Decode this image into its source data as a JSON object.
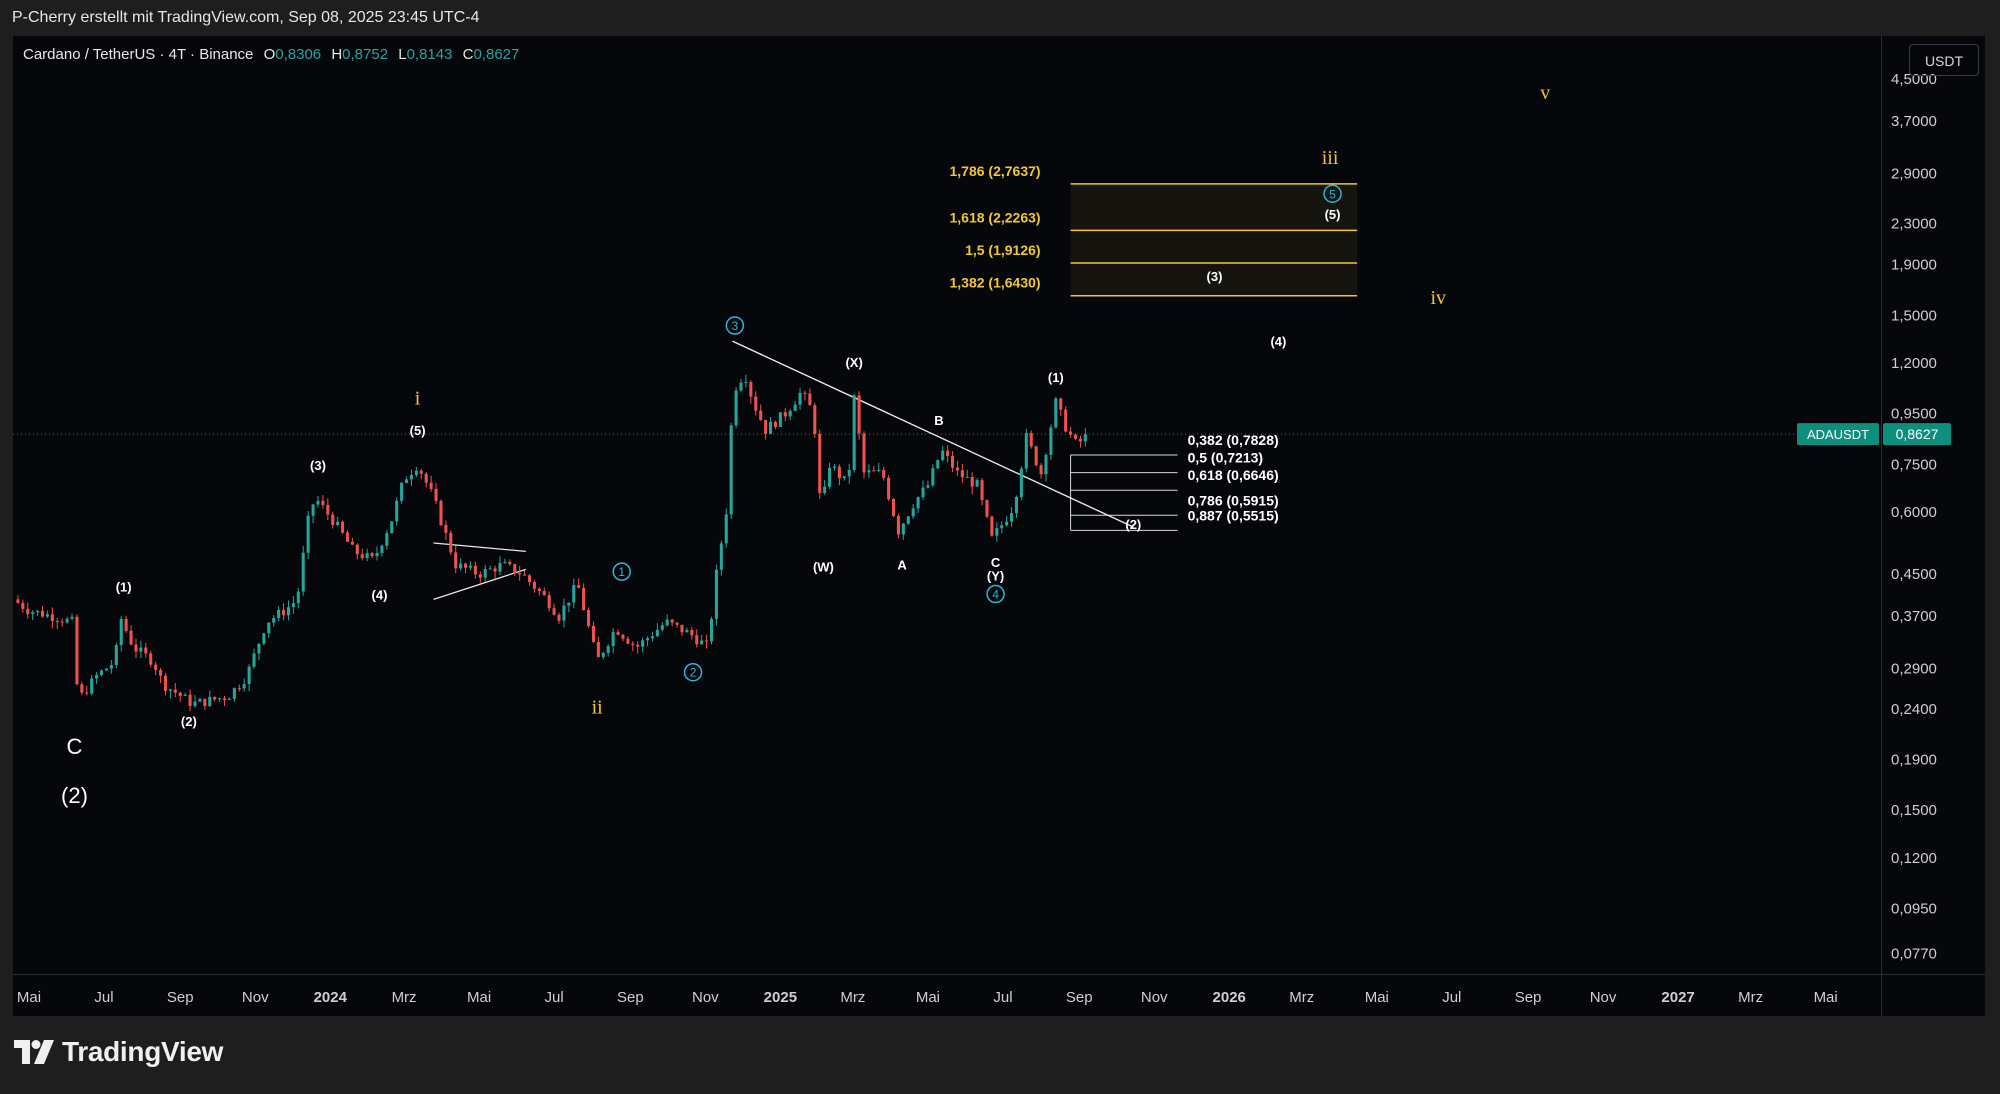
{
  "header": {
    "credit": "P-Cherry erstellt mit TradingView.com, Sep 08, 2025 23:45 UTC-4"
  },
  "symbol": {
    "name": "Cardano / TetherUS · 4T · Binance",
    "o_label": "O",
    "o_value": "0,8306",
    "h_label": "H",
    "h_value": "0,8752",
    "l_label": "L",
    "l_value": "0,8143",
    "c_label": "C",
    "c_value": "0,8627"
  },
  "currency_button": "USDT",
  "price_tag": {
    "ticker": "ADAUSDT",
    "value": "0,8627",
    "price": 0.8627
  },
  "brand": {
    "name": "TradingView"
  },
  "colors": {
    "background": "#06070b",
    "up": "#26a69a",
    "down": "#ef5350",
    "fib_target": "#f2c53d",
    "circle_wave": "#2fb6d8",
    "text": "#e8e8e8"
  },
  "chart_data": {
    "type": "candlestick",
    "symbol": "ADAUSDT",
    "timeframe": "4T",
    "yscale": "log",
    "ylim": [
      0.07,
      5.5
    ],
    "xlim": [
      "2023-04-18",
      "2027-06-15"
    ],
    "y_ticks": [
      {
        "value": 4.5,
        "label": "4,5000"
      },
      {
        "value": 3.7,
        "label": "3,7000"
      },
      {
        "value": 2.9,
        "label": "2,9000"
      },
      {
        "value": 2.3,
        "label": "2,3000"
      },
      {
        "value": 1.9,
        "label": "1,9000"
      },
      {
        "value": 1.5,
        "label": "1,5000"
      },
      {
        "value": 1.2,
        "label": "1,2000"
      },
      {
        "value": 0.95,
        "label": "0,9500"
      },
      {
        "value": 0.75,
        "label": "0,7500"
      },
      {
        "value": 0.6,
        "label": "0,6000"
      },
      {
        "value": 0.45,
        "label": "0,4500"
      },
      {
        "value": 0.37,
        "label": "0,3700"
      },
      {
        "value": 0.29,
        "label": "0,2900"
      },
      {
        "value": 0.24,
        "label": "0,2400"
      },
      {
        "value": 0.19,
        "label": "0,1900"
      },
      {
        "value": 0.15,
        "label": "0,1500"
      },
      {
        "value": 0.12,
        "label": "0,1200"
      },
      {
        "value": 0.095,
        "label": "0,0950"
      },
      {
        "value": 0.077,
        "label": "0,0770"
      }
    ],
    "x_ticks": [
      {
        "date": "2023-05-01",
        "label": "Mai",
        "bold": false
      },
      {
        "date": "2023-07-01",
        "label": "Jul",
        "bold": false
      },
      {
        "date": "2023-09-01",
        "label": "Sep",
        "bold": false
      },
      {
        "date": "2023-11-01",
        "label": "Nov",
        "bold": false
      },
      {
        "date": "2024-01-01",
        "label": "2024",
        "bold": true
      },
      {
        "date": "2024-03-01",
        "label": "Mrz",
        "bold": false
      },
      {
        "date": "2024-05-01",
        "label": "Mai",
        "bold": false
      },
      {
        "date": "2024-07-01",
        "label": "Jul",
        "bold": false
      },
      {
        "date": "2024-09-01",
        "label": "Sep",
        "bold": false
      },
      {
        "date": "2024-11-01",
        "label": "Nov",
        "bold": false
      },
      {
        "date": "2025-01-01",
        "label": "2025",
        "bold": true
      },
      {
        "date": "2025-03-01",
        "label": "Mrz",
        "bold": false
      },
      {
        "date": "2025-05-01",
        "label": "Mai",
        "bold": false
      },
      {
        "date": "2025-07-01",
        "label": "Jul",
        "bold": false
      },
      {
        "date": "2025-09-01",
        "label": "Sep",
        "bold": false
      },
      {
        "date": "2025-11-01",
        "label": "Nov",
        "bold": false
      },
      {
        "date": "2026-01-01",
        "label": "2026",
        "bold": true
      },
      {
        "date": "2026-03-01",
        "label": "Mrz",
        "bold": false
      },
      {
        "date": "2026-05-01",
        "label": "Mai",
        "bold": false
      },
      {
        "date": "2026-07-01",
        "label": "Jul",
        "bold": false
      },
      {
        "date": "2026-09-01",
        "label": "Sep",
        "bold": false
      },
      {
        "date": "2026-11-01",
        "label": "Nov",
        "bold": false
      },
      {
        "date": "2027-01-01",
        "label": "2027",
        "bold": true
      },
      {
        "date": "2027-03-01",
        "label": "Mrz",
        "bold": false
      },
      {
        "date": "2027-05-01",
        "label": "Mai",
        "bold": false
      }
    ],
    "price_path": [
      [
        "2023-04-18",
        0.4
      ],
      [
        "2023-05-01",
        0.38
      ],
      [
        "2023-05-20",
        0.37
      ],
      [
        "2023-06-05",
        0.36
      ],
      [
        "2023-06-10",
        0.25
      ],
      [
        "2023-06-25",
        0.28
      ],
      [
        "2023-07-10",
        0.3
      ],
      [
        "2023-07-14",
        0.37
      ],
      [
        "2023-07-25",
        0.32
      ],
      [
        "2023-08-10",
        0.3
      ],
      [
        "2023-08-18",
        0.27
      ],
      [
        "2023-09-11",
        0.246
      ],
      [
        "2023-09-25",
        0.25
      ],
      [
        "2023-10-10",
        0.255
      ],
      [
        "2023-10-25",
        0.28
      ],
      [
        "2023-11-10",
        0.36
      ],
      [
        "2023-11-25",
        0.38
      ],
      [
        "2023-12-05",
        0.4
      ],
      [
        "2023-12-15",
        0.6
      ],
      [
        "2023-12-20",
        0.64
      ],
      [
        "2024-01-05",
        0.57
      ],
      [
        "2024-01-20",
        0.5
      ],
      [
        "2024-02-05",
        0.48
      ],
      [
        "2024-02-20",
        0.58
      ],
      [
        "2024-03-01",
        0.7
      ],
      [
        "2024-03-12",
        0.75
      ],
      [
        "2024-03-25",
        0.64
      ],
      [
        "2024-04-12",
        0.47
      ],
      [
        "2024-05-01",
        0.45
      ],
      [
        "2024-05-20",
        0.47
      ],
      [
        "2024-06-05",
        0.45
      ],
      [
        "2024-06-25",
        0.4
      ],
      [
        "2024-07-05",
        0.37
      ],
      [
        "2024-07-20",
        0.43
      ],
      [
        "2024-08-05",
        0.3
      ],
      [
        "2024-08-20",
        0.35
      ],
      [
        "2024-09-06",
        0.32
      ],
      [
        "2024-09-30",
        0.36
      ],
      [
        "2024-10-20",
        0.34
      ],
      [
        "2024-11-03",
        0.32
      ],
      [
        "2024-11-10",
        0.45
      ],
      [
        "2024-11-20",
        0.65
      ],
      [
        "2024-11-23",
        1.05
      ],
      [
        "2024-12-03",
        1.15
      ],
      [
        "2024-12-10",
        1.0
      ],
      [
        "2024-12-20",
        0.88
      ],
      [
        "2025-01-05",
        0.95
      ],
      [
        "2025-01-18",
        1.05
      ],
      [
        "2025-01-28",
        0.95
      ],
      [
        "2025-02-03",
        0.6
      ],
      [
        "2025-02-10",
        0.75
      ],
      [
        "2025-02-25",
        0.68
      ],
      [
        "2025-03-02",
        1.02
      ],
      [
        "2025-03-10",
        0.72
      ],
      [
        "2025-03-25",
        0.72
      ],
      [
        "2025-04-07",
        0.55
      ],
      [
        "2025-04-20",
        0.63
      ],
      [
        "2025-05-01",
        0.68
      ],
      [
        "2025-05-12",
        0.8
      ],
      [
        "2025-05-25",
        0.72
      ],
      [
        "2025-06-10",
        0.68
      ],
      [
        "2025-06-22",
        0.53
      ],
      [
        "2025-07-01",
        0.57
      ],
      [
        "2025-07-10",
        0.62
      ],
      [
        "2025-07-20",
        0.85
      ],
      [
        "2025-08-01",
        0.72
      ],
      [
        "2025-08-13",
        1.0
      ],
      [
        "2025-08-22",
        0.88
      ],
      [
        "2025-08-30",
        0.82
      ],
      [
        "2025-09-08",
        0.8627
      ]
    ],
    "fib_extensions": [
      {
        "label": "1,786 (2,7637)",
        "value": 2.7637
      },
      {
        "label": "1,618 (2,2263)",
        "value": 2.2263
      },
      {
        "label": "1,5 (1,9126)",
        "value": 1.9126
      },
      {
        "label": "1,382 (1,6430)",
        "value": 1.643
      }
    ],
    "fib_retracements": [
      {
        "label": "0,382 (0,7828)",
        "value": 0.7828
      },
      {
        "label": "0,5 (0,7213)",
        "value": 0.7213
      },
      {
        "label": "0,618 (0,6646)",
        "value": 0.6646
      },
      {
        "label": "0,786 (0,5915)",
        "value": 0.5915
      },
      {
        "label": "0,887 (0,5515)",
        "value": 0.5515
      }
    ],
    "fib_ext_range": [
      "2025-08-25",
      "2026-04-15"
    ],
    "fib_ret_range": [
      "2025-08-25",
      "2025-11-20"
    ],
    "trendline": [
      [
        "2024-11-23",
        1.33
      ],
      [
        "2025-10-15",
        0.56
      ]
    ],
    "triangle": {
      "upper": [
        [
          "2024-03-25",
          0.52
        ],
        [
          "2024-06-08",
          0.5
        ]
      ],
      "lower": [
        [
          "2024-03-25",
          0.4
        ],
        [
          "2024-06-08",
          0.46
        ]
      ]
    },
    "wave_labels": [
      {
        "text": "C",
        "date": "2023-06-07",
        "price": 0.195,
        "style": "white-large"
      },
      {
        "text": "(2)",
        "date": "2023-06-07",
        "price": 0.155,
        "style": "white-large"
      },
      {
        "text": "(1)",
        "date": "2023-07-17",
        "price": 0.415,
        "style": "white"
      },
      {
        "text": "(2)",
        "date": "2023-09-08",
        "price": 0.222,
        "style": "white"
      },
      {
        "text": "(3)",
        "date": "2023-12-22",
        "price": 0.73,
        "style": "white"
      },
      {
        "text": "(4)",
        "date": "2024-02-10",
        "price": 0.4,
        "style": "white"
      },
      {
        "text": "(5)",
        "date": "2024-03-12",
        "price": 0.86,
        "style": "white"
      },
      {
        "text": "i",
        "date": "2024-03-12",
        "price": 0.99,
        "style": "yellow"
      },
      {
        "text": "ii",
        "date": "2024-08-05",
        "price": 0.235,
        "style": "yellow"
      },
      {
        "text": "1",
        "date": "2024-08-25",
        "price": 0.455,
        "style": "circle"
      },
      {
        "text": "2",
        "date": "2024-10-22",
        "price": 0.285,
        "style": "circle"
      },
      {
        "text": "3",
        "date": "2024-11-25",
        "price": 1.43,
        "style": "circle"
      },
      {
        "text": "(W)",
        "date": "2025-02-05",
        "price": 0.455,
        "style": "white"
      },
      {
        "text": "(X)",
        "date": "2025-03-02",
        "price": 1.18,
        "style": "white"
      },
      {
        "text": "A",
        "date": "2025-04-10",
        "price": 0.46,
        "style": "white"
      },
      {
        "text": "B",
        "date": "2025-05-10",
        "price": 0.9,
        "style": "white"
      },
      {
        "text": "C",
        "date": "2025-06-25",
        "price": 0.465,
        "style": "white"
      },
      {
        "text": "(Y)",
        "date": "2025-06-25",
        "price": 0.437,
        "style": "white"
      },
      {
        "text": "4",
        "date": "2025-06-25",
        "price": 0.41,
        "style": "circle"
      },
      {
        "text": "(1)",
        "date": "2025-08-13",
        "price": 1.1,
        "style": "white"
      },
      {
        "text": "(2)",
        "date": "2025-10-15",
        "price": 0.555,
        "style": "white"
      },
      {
        "text": "(3)",
        "date": "2025-12-20",
        "price": 1.76,
        "style": "white"
      },
      {
        "text": "(4)",
        "date": "2026-02-10",
        "price": 1.3,
        "style": "white"
      },
      {
        "text": "(5)",
        "date": "2026-03-26",
        "price": 2.35,
        "style": "white"
      },
      {
        "text": "5",
        "date": "2026-03-26",
        "price": 2.64,
        "style": "circle"
      },
      {
        "text": "iii",
        "date": "2026-03-24",
        "price": 3.03,
        "style": "yellow"
      },
      {
        "text": "iv",
        "date": "2026-06-20",
        "price": 1.58,
        "style": "yellow"
      },
      {
        "text": "v",
        "date": "2026-09-15",
        "price": 4.1,
        "style": "yellow"
      }
    ]
  }
}
